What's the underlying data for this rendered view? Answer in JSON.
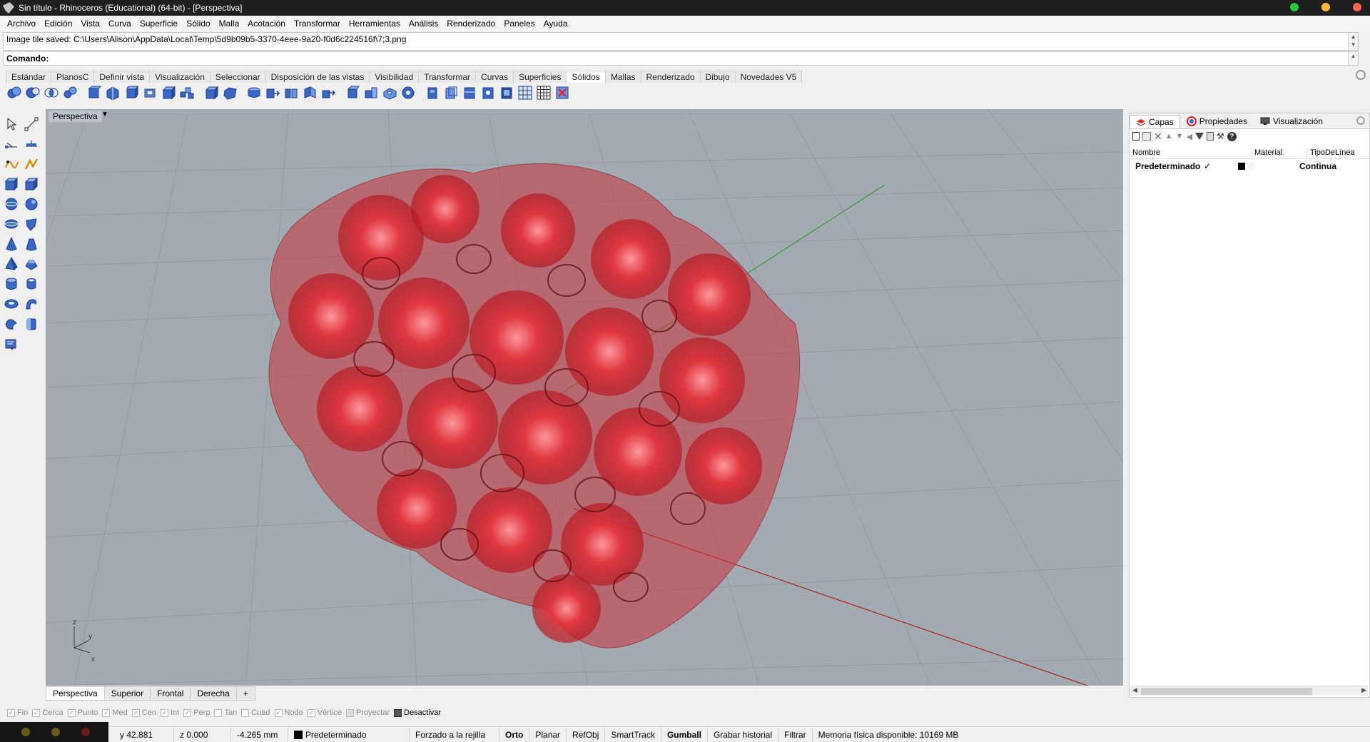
{
  "window": {
    "title": "Sin título - Rhinoceros (Educational) (64-bit) - [Perspectiva]",
    "controls": {
      "minimize_color": "#27c93f",
      "maximize_color": "#ffbd2e",
      "close_color": "#ff5f56"
    }
  },
  "menu": [
    "Archivo",
    "Edición",
    "Vista",
    "Curva",
    "Superficie",
    "Sólido",
    "Malla",
    "Acotación",
    "Transformar",
    "Herramientas",
    "Análisis",
    "Renderizado",
    "Paneles",
    "Ayuda"
  ],
  "command": {
    "history": "Image tile saved: C:\\Users\\Alison\\AppData\\Local\\Temp\\5d9b09b5-3370-4eee-9a20-f0d6c224516f\\7;3.png",
    "prompt_label": "Comando:"
  },
  "toolbar_tabs": [
    {
      "label": "Estándar",
      "active": false
    },
    {
      "label": "PlanosC",
      "active": false
    },
    {
      "label": "Definir vista",
      "active": false
    },
    {
      "label": "Visualización",
      "active": false
    },
    {
      "label": "Seleccionar",
      "active": false
    },
    {
      "label": "Disposición de las vistas",
      "active": false
    },
    {
      "label": "Visibilidad",
      "active": false
    },
    {
      "label": "Transformar",
      "active": false
    },
    {
      "label": "Curvas",
      "active": false
    },
    {
      "label": "Superficies",
      "active": false
    },
    {
      "label": "Sólidos",
      "active": true
    },
    {
      "label": "Mallas",
      "active": false
    },
    {
      "label": "Renderizado",
      "active": false
    },
    {
      "label": "Dibujo",
      "active": false
    },
    {
      "label": "Novedades V5",
      "active": false
    }
  ],
  "viewport": {
    "label": "Perspectiva",
    "tabs": [
      {
        "label": "Perspectiva",
        "active": true
      },
      {
        "label": "Superior",
        "active": false
      },
      {
        "label": "Frontal",
        "active": false
      },
      {
        "label": "Derecha",
        "active": false
      },
      {
        "label": "+",
        "active": false
      }
    ],
    "background_color": "#a2aab2",
    "model_color": "#d8262e",
    "axis_labels": {
      "z": "z",
      "y": "y",
      "x": "x"
    }
  },
  "panel": {
    "tabs": [
      {
        "label": "Capas",
        "icon": "layers-icon",
        "active": true
      },
      {
        "label": "Propiedades",
        "icon": "properties-icon",
        "active": false
      },
      {
        "label": "Visualización",
        "icon": "display-icon",
        "active": false
      }
    ],
    "columns": [
      "Nombre",
      "Material",
      "TipoDeLínea"
    ],
    "layers": [
      {
        "name": "Predeterminado",
        "current": "✓",
        "color": "#000000",
        "linetype": "Continua"
      }
    ]
  },
  "osnaps": [
    {
      "label": "Fin",
      "checked": true
    },
    {
      "label": "Cerca",
      "checked": true
    },
    {
      "label": "Punto",
      "checked": true
    },
    {
      "label": "Med",
      "checked": true
    },
    {
      "label": "Cen",
      "checked": true
    },
    {
      "label": "Int",
      "checked": true
    },
    {
      "label": "Perp",
      "checked": true
    },
    {
      "label": "Tan",
      "checked": false
    },
    {
      "label": "Cuad",
      "checked": false
    },
    {
      "label": "Nodo",
      "checked": true
    },
    {
      "label": "Vértice",
      "checked": true
    },
    {
      "label": "Proyectar",
      "checked": false
    }
  ],
  "osnap_disable_label": "Desactivar",
  "status": {
    "y": "y 42.881",
    "z": "z 0.000",
    "distance": "-4.265 mm",
    "layer": "Predeterminado",
    "grid_snap": "Forzado a la rejilla",
    "ortho": "Orto",
    "planar": "Planar",
    "osnap": "RefObj",
    "smarttrack": "SmartTrack",
    "gumball": "Gumball",
    "history": "Grabar historial",
    "filter": "Filtrar",
    "memory": "Memoria física disponible: 10169 MB"
  }
}
